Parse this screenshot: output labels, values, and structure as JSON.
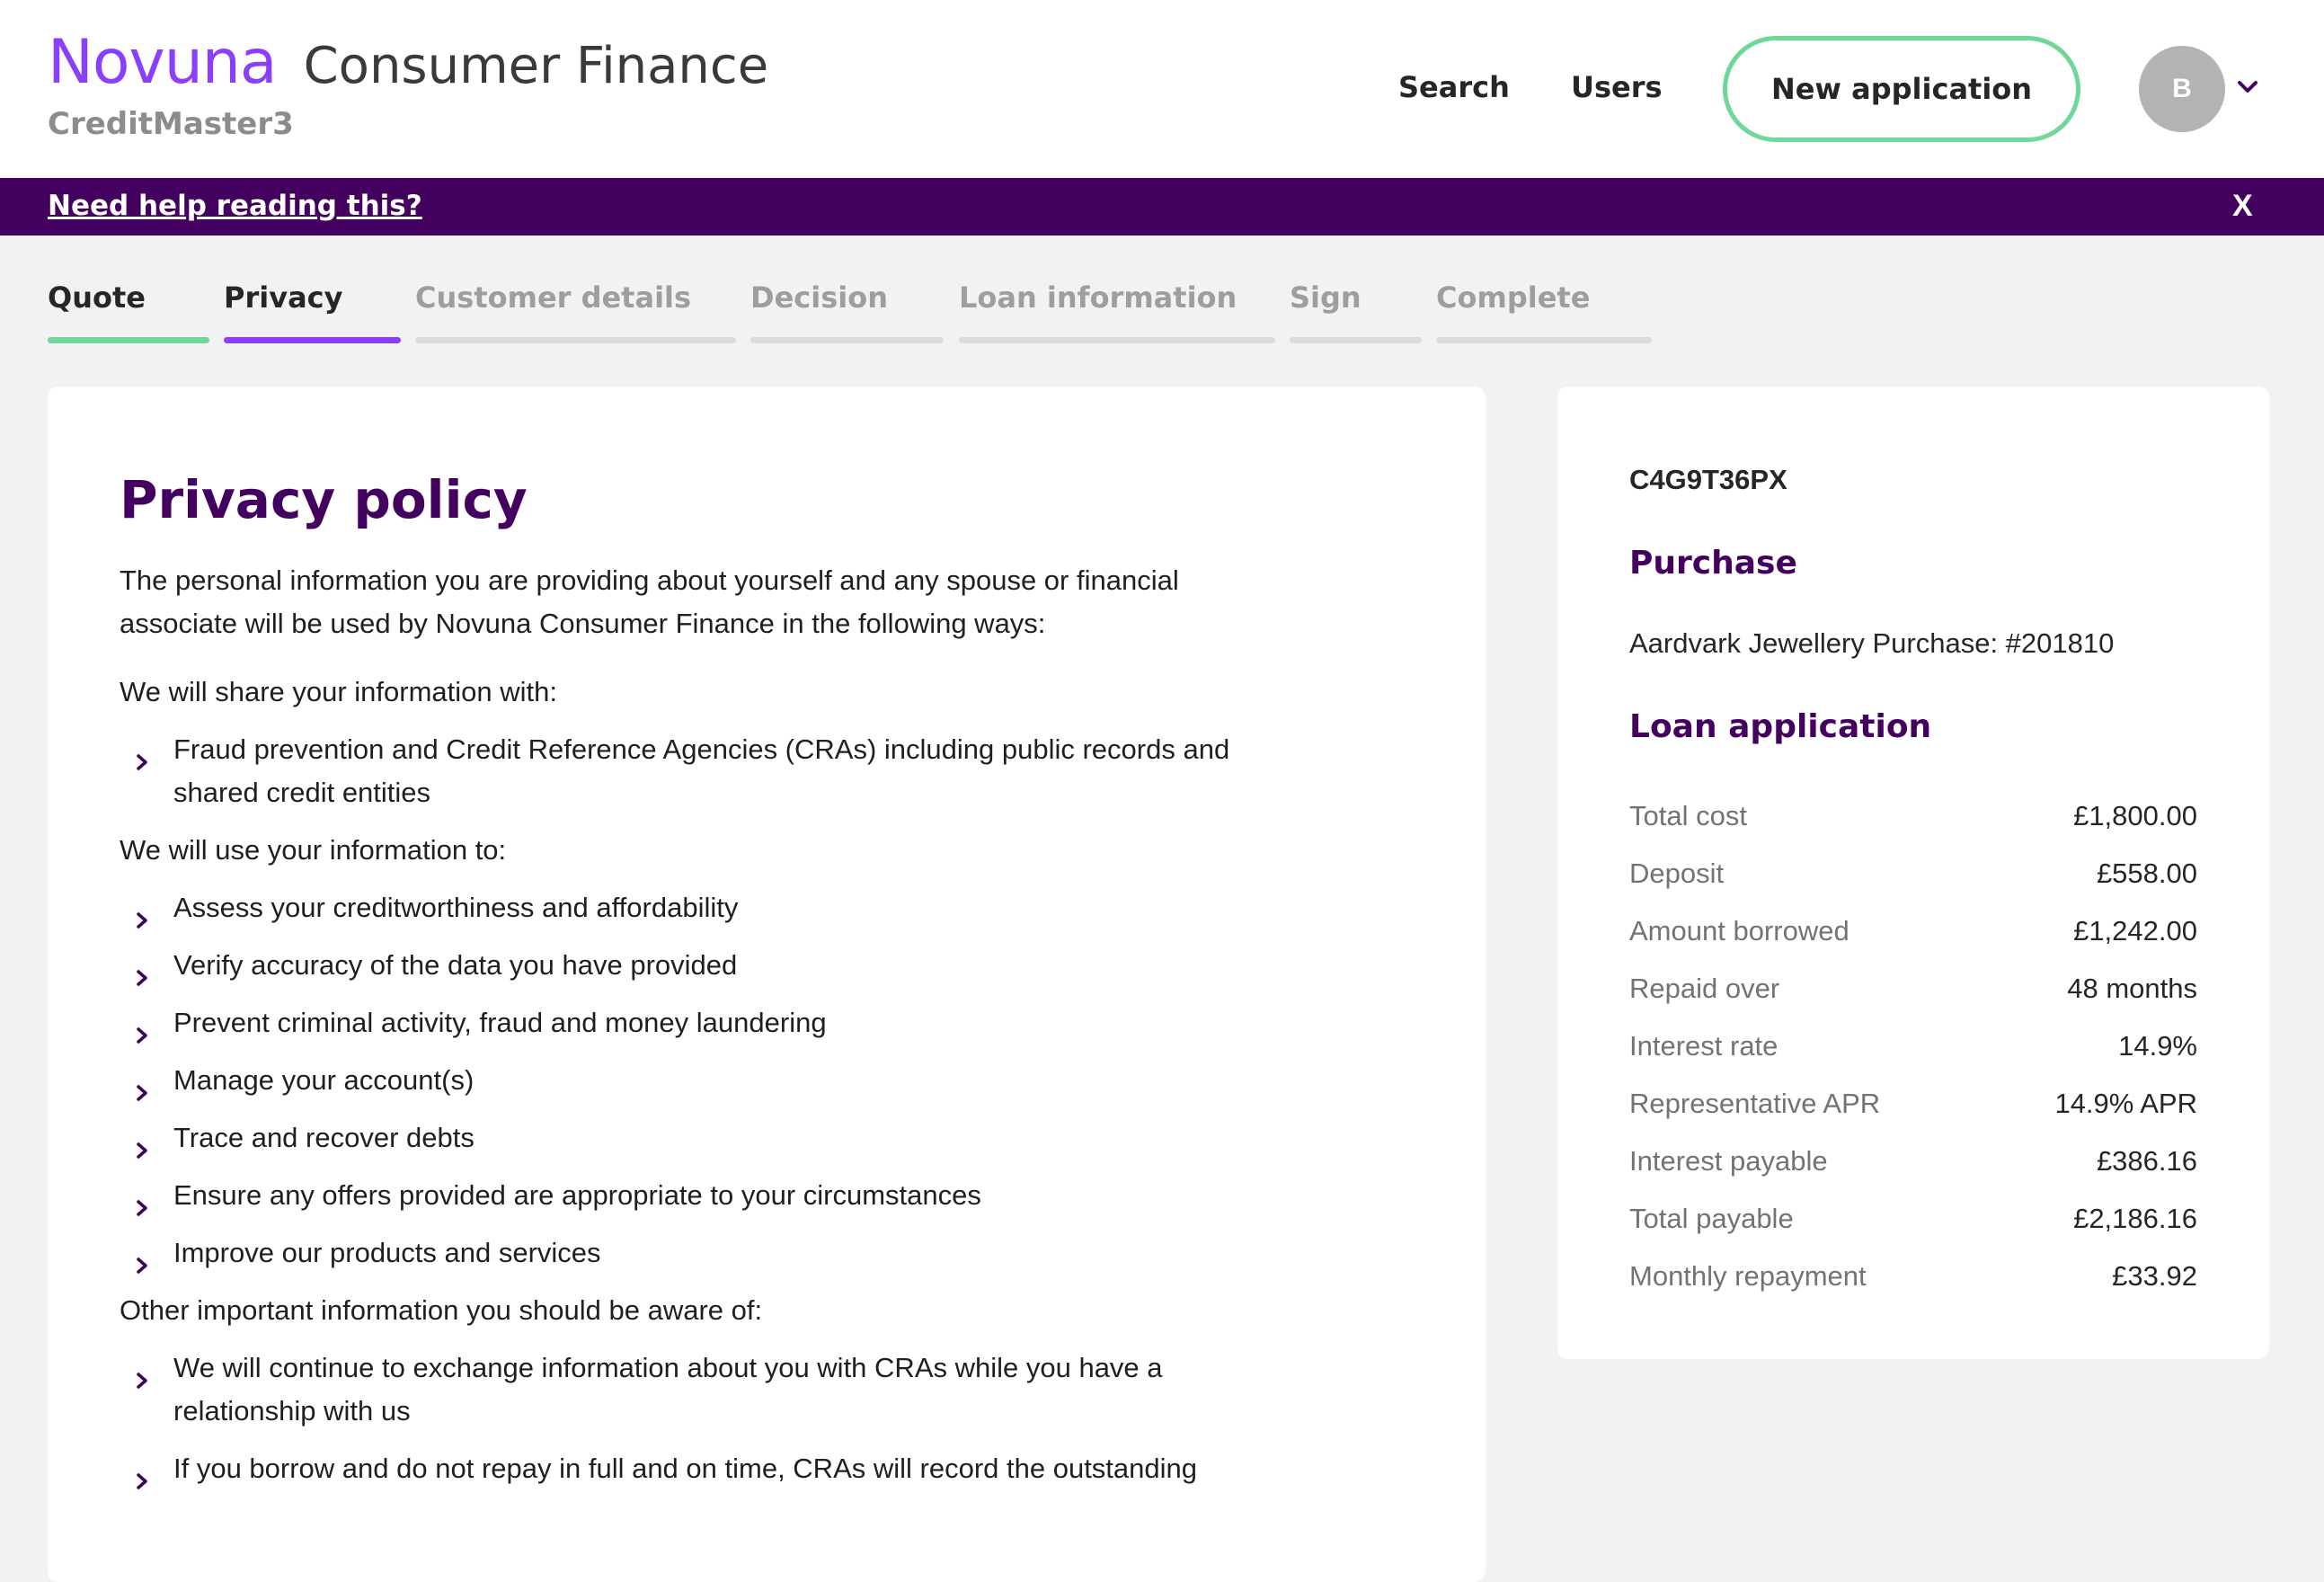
{
  "header": {
    "brand_name": "Novuna",
    "brand_subtitle": "Consumer Finance",
    "product_name": "CreditMaster3",
    "nav": {
      "search": "Search",
      "users": "Users"
    },
    "new_application_label": "New application",
    "avatar_initial": "B"
  },
  "help_banner": {
    "link_text": "Need help reading this?",
    "close_label": "X"
  },
  "steps": [
    {
      "label": "Quote",
      "state": "done"
    },
    {
      "label": "Privacy",
      "state": "active"
    },
    {
      "label": "Customer details",
      "state": "pending"
    },
    {
      "label": "Decision",
      "state": "pending"
    },
    {
      "label": "Loan information",
      "state": "pending"
    },
    {
      "label": "Sign",
      "state": "pending"
    },
    {
      "label": "Complete",
      "state": "pending"
    }
  ],
  "privacy": {
    "title": "Privacy policy",
    "intro": "The personal information you are providing about yourself and any spouse or financial associate will be used by Novuna Consumer Finance in the following ways:",
    "share_heading": "We will share your information with:",
    "share_items": [
      "Fraud prevention and Credit Reference Agencies (CRAs) including public records and shared credit entities"
    ],
    "use_heading": "We will use your information to:",
    "use_items": [
      "Assess your creditworthiness and affordability",
      "Verify accuracy of the data you have provided",
      "Prevent criminal activity, fraud and money laundering",
      "Manage your account(s)",
      "Trace and recover debts",
      "Ensure any offers provided are appropriate to your circumstances",
      "Improve our products and services"
    ],
    "other_heading": "Other important information you should be aware of:",
    "other_items": [
      "We will continue to exchange information about you with CRAs while you have a relationship with us",
      "If you borrow and do not repay in full and on time, CRAs will record the outstanding"
    ]
  },
  "summary": {
    "reference": "C4G9T36PX",
    "purchase_heading": "Purchase",
    "purchase_text": "Aardvark Jewellery Purchase: #201810",
    "loan_heading": "Loan application",
    "loan_rows": [
      {
        "label": "Total cost",
        "value": "£1,800.00"
      },
      {
        "label": "Deposit",
        "value": "£558.00"
      },
      {
        "label": "Amount borrowed",
        "value": "£1,242.00"
      },
      {
        "label": "Repaid over",
        "value": "48 months"
      },
      {
        "label": "Interest rate",
        "value": "14.9%"
      },
      {
        "label": "Representative APR",
        "value": "14.9% APR"
      },
      {
        "label": "Interest payable",
        "value": "£386.16"
      },
      {
        "label": "Total payable",
        "value": "£2,186.16"
      },
      {
        "label": "Monthly repayment",
        "value": "£33.92"
      }
    ]
  },
  "colors": {
    "brand_purple": "#8a3ffc",
    "dark_purple": "#44005f",
    "complete_green": "#6fd79a",
    "page_bg": "#f2f2f5"
  }
}
